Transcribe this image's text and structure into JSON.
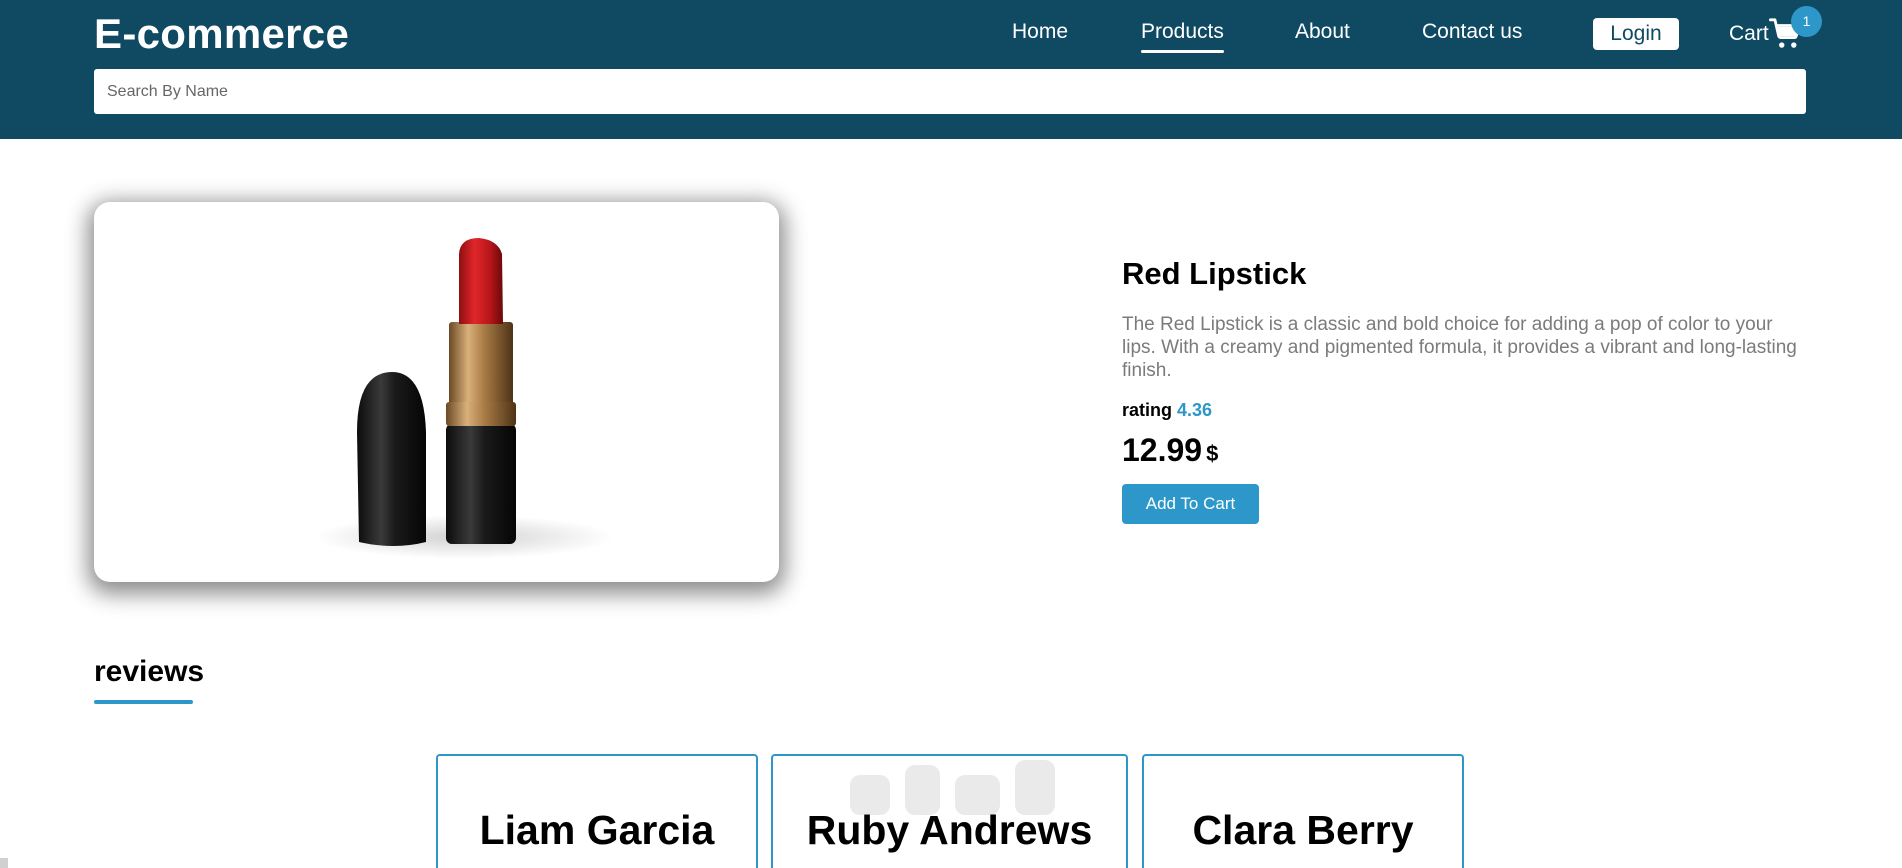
{
  "header": {
    "brand": "E-commerce",
    "nav": [
      {
        "label": "Home",
        "active": false
      },
      {
        "label": "Products",
        "active": true
      },
      {
        "label": "About",
        "active": false
      },
      {
        "label": "Contact us",
        "active": false
      }
    ],
    "login_label": "Login",
    "cart_label": "Cart",
    "cart_count": "1",
    "cart_icon": "shopping-cart-icon"
  },
  "search": {
    "placeholder": "Search By Name",
    "value": ""
  },
  "product": {
    "title": "Red Lipstick",
    "description": "The Red Lipstick is a classic and bold choice for adding a pop of color to your lips. With a creamy and pigmented formula, it provides a vibrant and long-lasting finish.",
    "rating_label": "rating",
    "rating_value": "4.36",
    "price": "12.99",
    "currency": "$",
    "add_to_cart_label": "Add To Cart"
  },
  "reviews": {
    "title": "reviews",
    "items": [
      {
        "name": "Liam Garcia"
      },
      {
        "name": "Ruby Andrews"
      },
      {
        "name": "Clara Berry"
      }
    ]
  },
  "colors": {
    "header_bg": "#0f4a62",
    "accent": "#2e97c9"
  }
}
